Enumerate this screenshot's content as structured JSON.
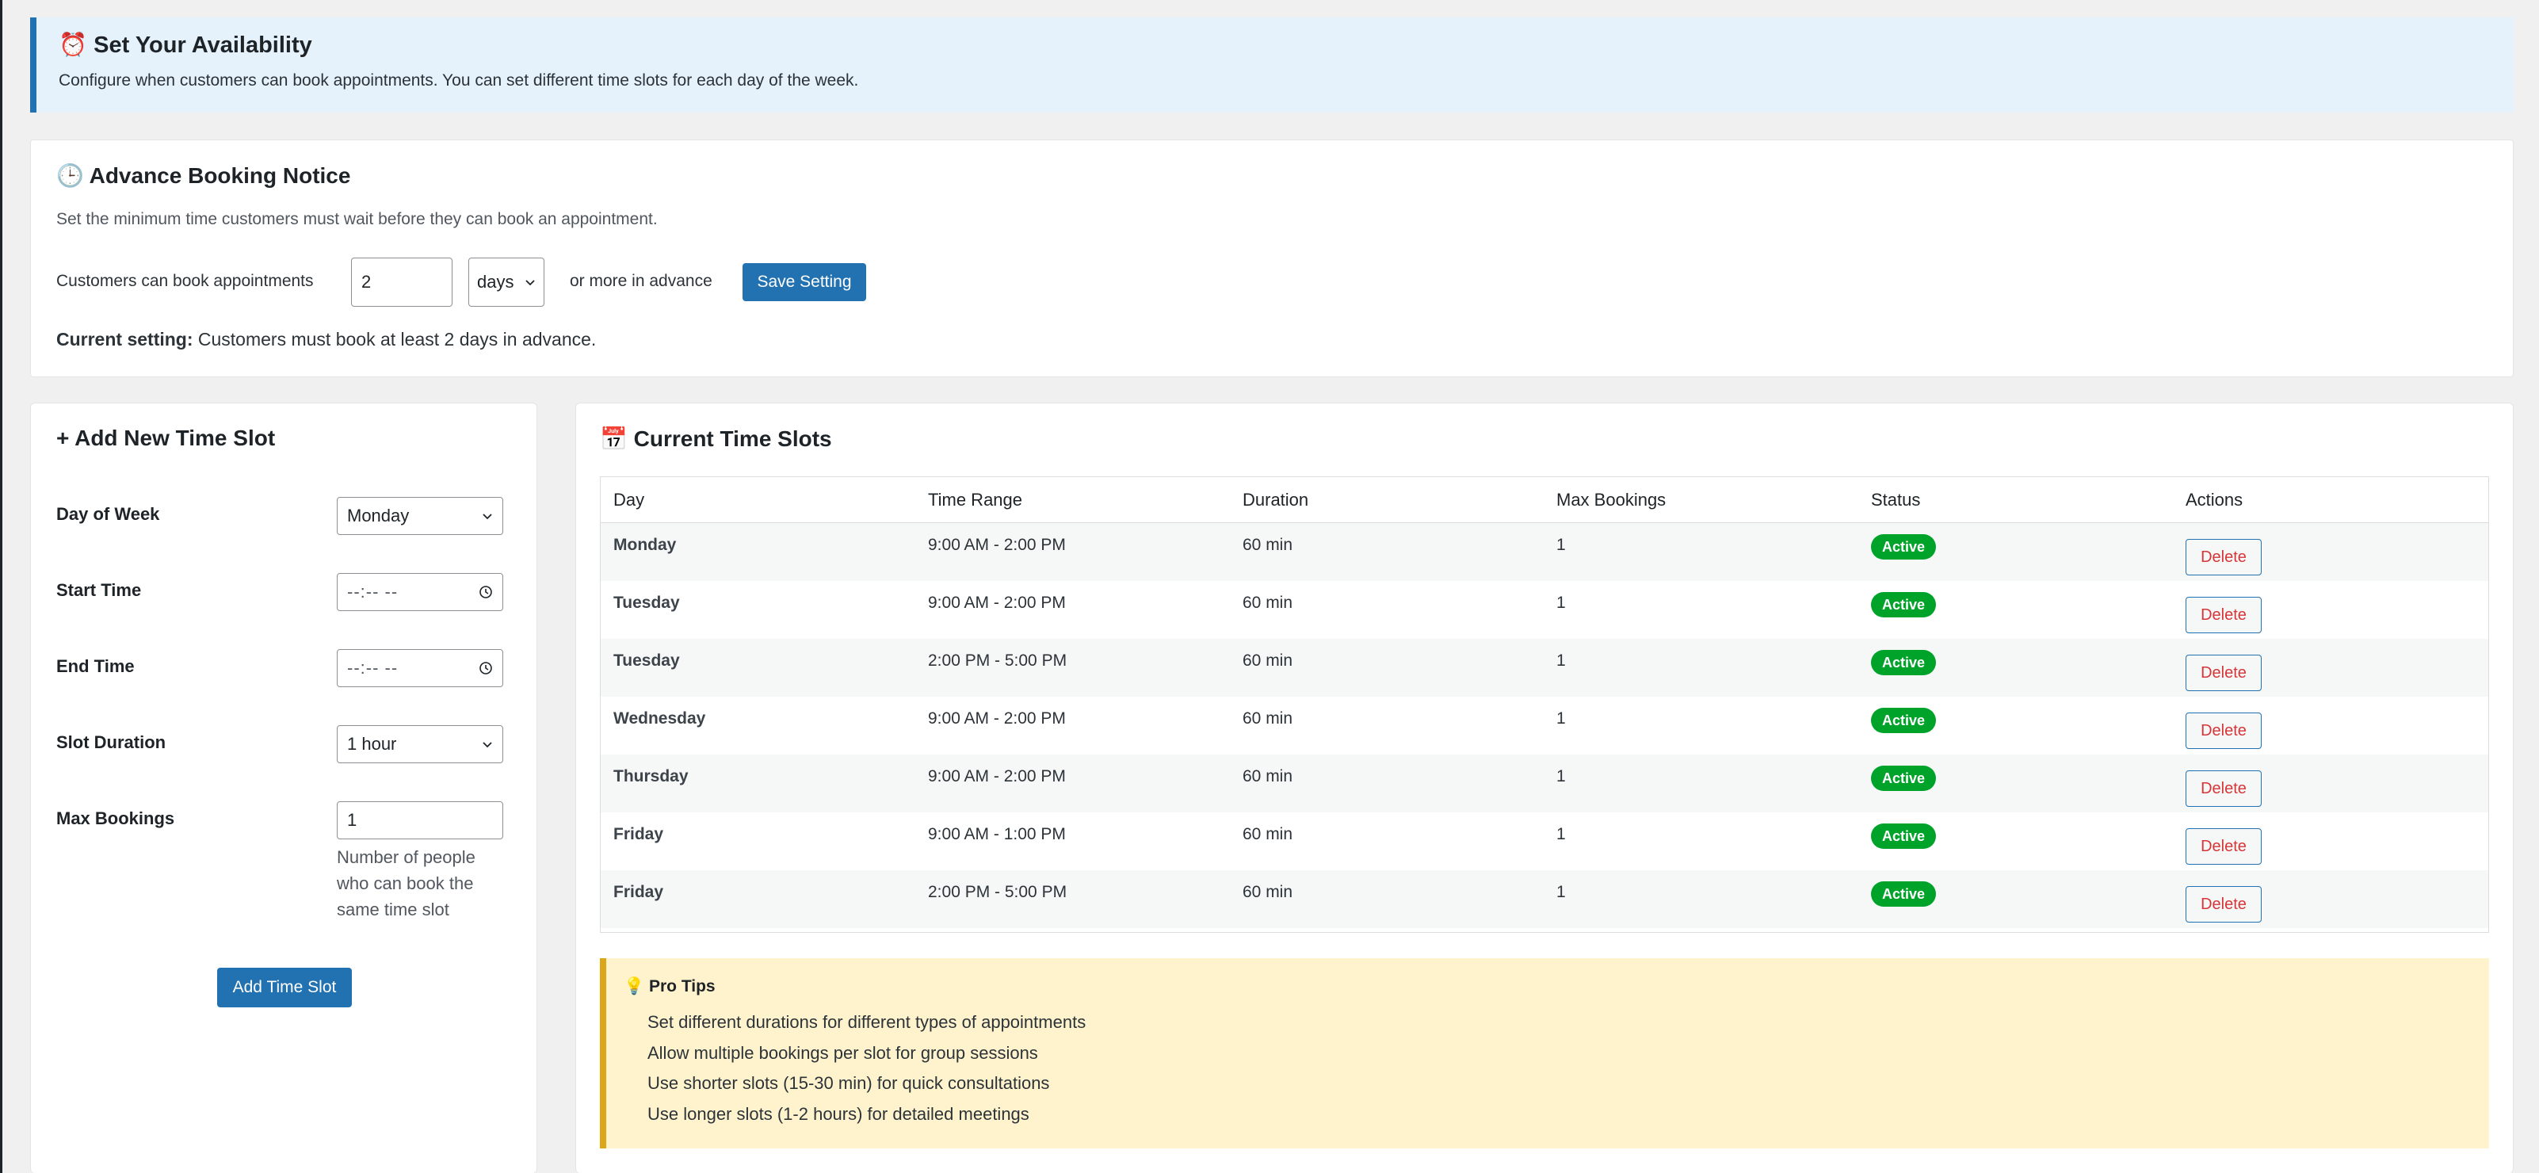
{
  "availability_notice": {
    "icon": "alarm-clock-icon",
    "title": "⏰ Set Your Availability",
    "description": "Configure when customers can book appointments. You can set different time slots for each day of the week."
  },
  "advance": {
    "title": "🕒 Advance Booking Notice",
    "subtitle": "Set the minimum time customers must wait before they can book an appointment.",
    "row_label": "Customers can book appointments",
    "value": "2",
    "unit": "days",
    "suffix": "or more in advance",
    "save_label": "Save Setting",
    "current_label": "Current setting:",
    "current_text": " Customers must book at least 2 days in advance."
  },
  "add_slot": {
    "title": "+ Add New Time Slot",
    "day_label": "Day of Week",
    "day_value": "Monday",
    "start_label": "Start Time",
    "start_placeholder": "--:-- --",
    "end_label": "End Time",
    "end_placeholder": "--:-- --",
    "duration_label": "Slot Duration",
    "duration_value": "1 hour",
    "max_label": "Max Bookings",
    "max_value": "1",
    "help": "Number of people who can book the same time slot",
    "add_label": "Add Time Slot"
  },
  "slots": {
    "title": "📅 Current Time Slots",
    "headers": [
      "Day",
      "Time Range",
      "Duration",
      "Max Bookings",
      "Status",
      "Actions"
    ],
    "rows": [
      {
        "day": "Monday",
        "range": "9:00 AM - 2:00 PM",
        "duration": "60 min",
        "max": "1",
        "status": "Active",
        "action": "Delete"
      },
      {
        "day": "Tuesday",
        "range": "9:00 AM - 2:00 PM",
        "duration": "60 min",
        "max": "1",
        "status": "Active",
        "action": "Delete"
      },
      {
        "day": "Tuesday",
        "range": "2:00 PM - 5:00 PM",
        "duration": "60 min",
        "max": "1",
        "status": "Active",
        "action": "Delete"
      },
      {
        "day": "Wednesday",
        "range": "9:00 AM - 2:00 PM",
        "duration": "60 min",
        "max": "1",
        "status": "Active",
        "action": "Delete"
      },
      {
        "day": "Thursday",
        "range": "9:00 AM - 2:00 PM",
        "duration": "60 min",
        "max": "1",
        "status": "Active",
        "action": "Delete"
      },
      {
        "day": "Friday",
        "range": "9:00 AM - 1:00 PM",
        "duration": "60 min",
        "max": "1",
        "status": "Active",
        "action": "Delete"
      },
      {
        "day": "Friday",
        "range": "2:00 PM - 5:00 PM",
        "duration": "60 min",
        "max": "1",
        "status": "Active",
        "action": "Delete"
      }
    ]
  },
  "tips": {
    "title": "💡 Pro Tips",
    "items": [
      "Set different durations for different types of appointments",
      "Allow multiple bookings per slot for group sessions",
      "Use shorter slots (15-30 min) for quick consultations",
      "Use longer slots (1-2 hours) for detailed meetings"
    ]
  },
  "colors": {
    "accent": "#2271b1",
    "active_badge": "#00a32a",
    "delete_text": "#d63638",
    "tips_bg": "#fff3cd",
    "notice_bg": "#e5f1fb"
  }
}
